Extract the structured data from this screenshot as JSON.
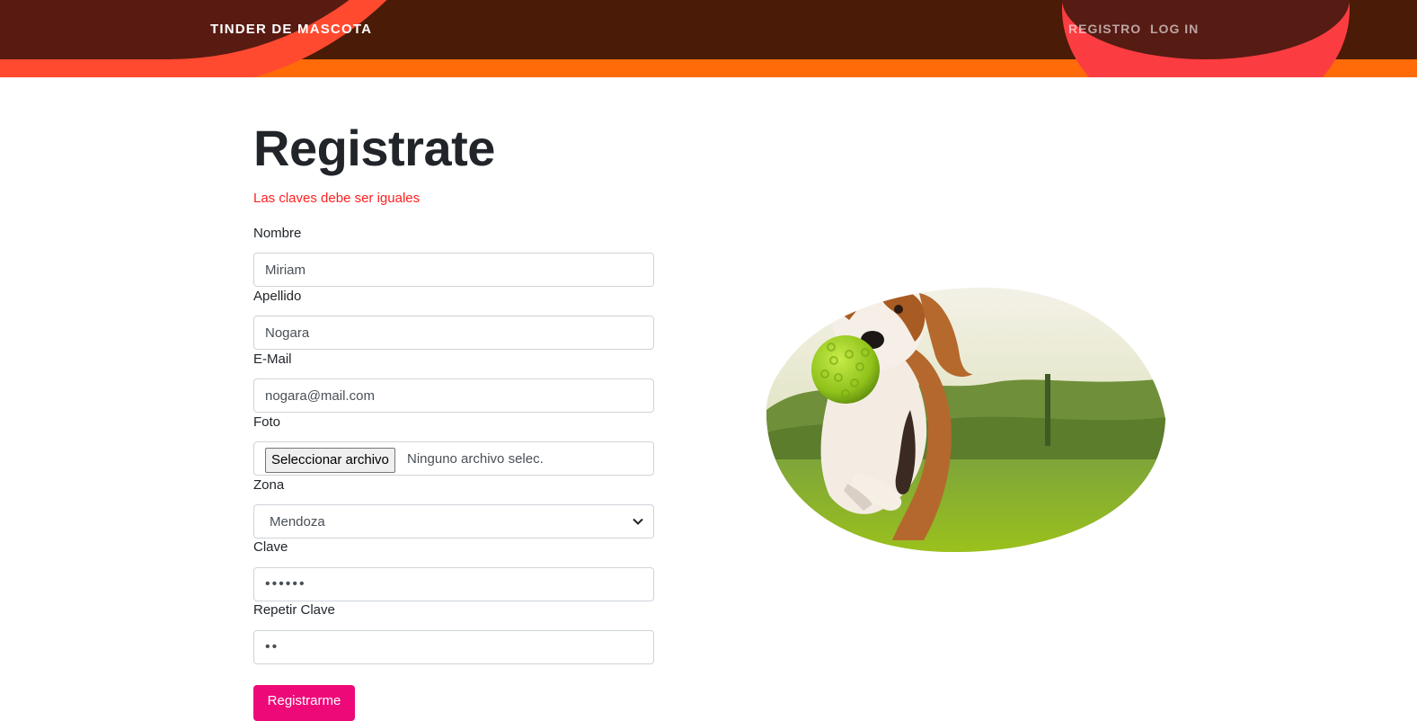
{
  "nav": {
    "brand": "TINDER DE MASCOTA",
    "links": [
      "REGISTRO",
      "LOG IN"
    ]
  },
  "form": {
    "title": "Registrate",
    "error": "Las claves debe ser iguales",
    "fields": {
      "nombre": {
        "label": "Nombre",
        "value": "Miriam"
      },
      "apellido": {
        "label": "Apellido",
        "value": "Nogara"
      },
      "email": {
        "label": "E-Mail",
        "value": "nogara@mail.com"
      },
      "foto": {
        "label": "Foto",
        "button": "Seleccionar archivo",
        "status": "Ninguno archivo selec."
      },
      "zona": {
        "label": "Zona",
        "selected": "Mendoza"
      },
      "clave": {
        "label": "Clave",
        "value": "••••••"
      },
      "repetir": {
        "label": "Repetir Clave",
        "value": "••"
      }
    },
    "submit": "Registrarme"
  },
  "colors": {
    "header_dark": "#4a1b07",
    "header_accent": "#ff6b08",
    "error": "#ff1f1f",
    "button": "#ee0979"
  },
  "image": {
    "subject": "beagle-with-green-ball"
  }
}
